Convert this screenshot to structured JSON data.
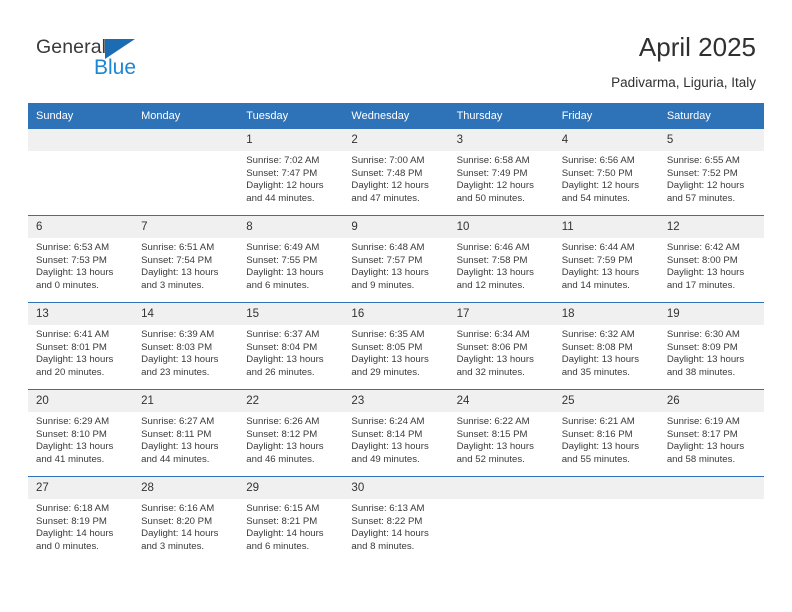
{
  "brand": {
    "name_top": "General",
    "name_bottom": "Blue",
    "color_dark": "#3a3a3a",
    "color_blue": "#1c86d4",
    "triangle_color": "#1c6cb4"
  },
  "header": {
    "title": "April 2025",
    "subtitle": "Padivarma, Liguria, Italy",
    "accent_color": "#2e72b8",
    "daynum_band_color": "#f0f0f0"
  },
  "weekday_headers": [
    "Sunday",
    "Monday",
    "Tuesday",
    "Wednesday",
    "Thursday",
    "Friday",
    "Saturday"
  ],
  "weeks": [
    [
      {
        "day": "",
        "empty": true,
        "sunrise": "",
        "sunset": "",
        "daylight1": "",
        "daylight2": ""
      },
      {
        "day": "",
        "empty": true,
        "sunrise": "",
        "sunset": "",
        "daylight1": "",
        "daylight2": ""
      },
      {
        "day": "1",
        "sunrise": "Sunrise: 7:02 AM",
        "sunset": "Sunset: 7:47 PM",
        "daylight1": "Daylight: 12 hours",
        "daylight2": "and 44 minutes."
      },
      {
        "day": "2",
        "sunrise": "Sunrise: 7:00 AM",
        "sunset": "Sunset: 7:48 PM",
        "daylight1": "Daylight: 12 hours",
        "daylight2": "and 47 minutes."
      },
      {
        "day": "3",
        "sunrise": "Sunrise: 6:58 AM",
        "sunset": "Sunset: 7:49 PM",
        "daylight1": "Daylight: 12 hours",
        "daylight2": "and 50 minutes."
      },
      {
        "day": "4",
        "sunrise": "Sunrise: 6:56 AM",
        "sunset": "Sunset: 7:50 PM",
        "daylight1": "Daylight: 12 hours",
        "daylight2": "and 54 minutes."
      },
      {
        "day": "5",
        "sunrise": "Sunrise: 6:55 AM",
        "sunset": "Sunset: 7:52 PM",
        "daylight1": "Daylight: 12 hours",
        "daylight2": "and 57 minutes."
      }
    ],
    [
      {
        "day": "6",
        "sunrise": "Sunrise: 6:53 AM",
        "sunset": "Sunset: 7:53 PM",
        "daylight1": "Daylight: 13 hours",
        "daylight2": "and 0 minutes."
      },
      {
        "day": "7",
        "sunrise": "Sunrise: 6:51 AM",
        "sunset": "Sunset: 7:54 PM",
        "daylight1": "Daylight: 13 hours",
        "daylight2": "and 3 minutes."
      },
      {
        "day": "8",
        "sunrise": "Sunrise: 6:49 AM",
        "sunset": "Sunset: 7:55 PM",
        "daylight1": "Daylight: 13 hours",
        "daylight2": "and 6 minutes."
      },
      {
        "day": "9",
        "sunrise": "Sunrise: 6:48 AM",
        "sunset": "Sunset: 7:57 PM",
        "daylight1": "Daylight: 13 hours",
        "daylight2": "and 9 minutes."
      },
      {
        "day": "10",
        "sunrise": "Sunrise: 6:46 AM",
        "sunset": "Sunset: 7:58 PM",
        "daylight1": "Daylight: 13 hours",
        "daylight2": "and 12 minutes."
      },
      {
        "day": "11",
        "sunrise": "Sunrise: 6:44 AM",
        "sunset": "Sunset: 7:59 PM",
        "daylight1": "Daylight: 13 hours",
        "daylight2": "and 14 minutes."
      },
      {
        "day": "12",
        "sunrise": "Sunrise: 6:42 AM",
        "sunset": "Sunset: 8:00 PM",
        "daylight1": "Daylight: 13 hours",
        "daylight2": "and 17 minutes."
      }
    ],
    [
      {
        "day": "13",
        "sunrise": "Sunrise: 6:41 AM",
        "sunset": "Sunset: 8:01 PM",
        "daylight1": "Daylight: 13 hours",
        "daylight2": "and 20 minutes."
      },
      {
        "day": "14",
        "sunrise": "Sunrise: 6:39 AM",
        "sunset": "Sunset: 8:03 PM",
        "daylight1": "Daylight: 13 hours",
        "daylight2": "and 23 minutes."
      },
      {
        "day": "15",
        "sunrise": "Sunrise: 6:37 AM",
        "sunset": "Sunset: 8:04 PM",
        "daylight1": "Daylight: 13 hours",
        "daylight2": "and 26 minutes."
      },
      {
        "day": "16",
        "sunrise": "Sunrise: 6:35 AM",
        "sunset": "Sunset: 8:05 PM",
        "daylight1": "Daylight: 13 hours",
        "daylight2": "and 29 minutes."
      },
      {
        "day": "17",
        "sunrise": "Sunrise: 6:34 AM",
        "sunset": "Sunset: 8:06 PM",
        "daylight1": "Daylight: 13 hours",
        "daylight2": "and 32 minutes."
      },
      {
        "day": "18",
        "sunrise": "Sunrise: 6:32 AM",
        "sunset": "Sunset: 8:08 PM",
        "daylight1": "Daylight: 13 hours",
        "daylight2": "and 35 minutes."
      },
      {
        "day": "19",
        "sunrise": "Sunrise: 6:30 AM",
        "sunset": "Sunset: 8:09 PM",
        "daylight1": "Daylight: 13 hours",
        "daylight2": "and 38 minutes."
      }
    ],
    [
      {
        "day": "20",
        "sunrise": "Sunrise: 6:29 AM",
        "sunset": "Sunset: 8:10 PM",
        "daylight1": "Daylight: 13 hours",
        "daylight2": "and 41 minutes."
      },
      {
        "day": "21",
        "sunrise": "Sunrise: 6:27 AM",
        "sunset": "Sunset: 8:11 PM",
        "daylight1": "Daylight: 13 hours",
        "daylight2": "and 44 minutes."
      },
      {
        "day": "22",
        "sunrise": "Sunrise: 6:26 AM",
        "sunset": "Sunset: 8:12 PM",
        "daylight1": "Daylight: 13 hours",
        "daylight2": "and 46 minutes."
      },
      {
        "day": "23",
        "sunrise": "Sunrise: 6:24 AM",
        "sunset": "Sunset: 8:14 PM",
        "daylight1": "Daylight: 13 hours",
        "daylight2": "and 49 minutes."
      },
      {
        "day": "24",
        "sunrise": "Sunrise: 6:22 AM",
        "sunset": "Sunset: 8:15 PM",
        "daylight1": "Daylight: 13 hours",
        "daylight2": "and 52 minutes."
      },
      {
        "day": "25",
        "sunrise": "Sunrise: 6:21 AM",
        "sunset": "Sunset: 8:16 PM",
        "daylight1": "Daylight: 13 hours",
        "daylight2": "and 55 minutes."
      },
      {
        "day": "26",
        "sunrise": "Sunrise: 6:19 AM",
        "sunset": "Sunset: 8:17 PM",
        "daylight1": "Daylight: 13 hours",
        "daylight2": "and 58 minutes."
      }
    ],
    [
      {
        "day": "27",
        "sunrise": "Sunrise: 6:18 AM",
        "sunset": "Sunset: 8:19 PM",
        "daylight1": "Daylight: 14 hours",
        "daylight2": "and 0 minutes."
      },
      {
        "day": "28",
        "sunrise": "Sunrise: 6:16 AM",
        "sunset": "Sunset: 8:20 PM",
        "daylight1": "Daylight: 14 hours",
        "daylight2": "and 3 minutes."
      },
      {
        "day": "29",
        "sunrise": "Sunrise: 6:15 AM",
        "sunset": "Sunset: 8:21 PM",
        "daylight1": "Daylight: 14 hours",
        "daylight2": "and 6 minutes."
      },
      {
        "day": "30",
        "sunrise": "Sunrise: 6:13 AM",
        "sunset": "Sunset: 8:22 PM",
        "daylight1": "Daylight: 14 hours",
        "daylight2": "and 8 minutes."
      },
      {
        "day": "",
        "empty": true,
        "sunrise": "",
        "sunset": "",
        "daylight1": "",
        "daylight2": ""
      },
      {
        "day": "",
        "empty": true,
        "sunrise": "",
        "sunset": "",
        "daylight1": "",
        "daylight2": ""
      },
      {
        "day": "",
        "empty": true,
        "sunrise": "",
        "sunset": "",
        "daylight1": "",
        "daylight2": ""
      }
    ]
  ]
}
